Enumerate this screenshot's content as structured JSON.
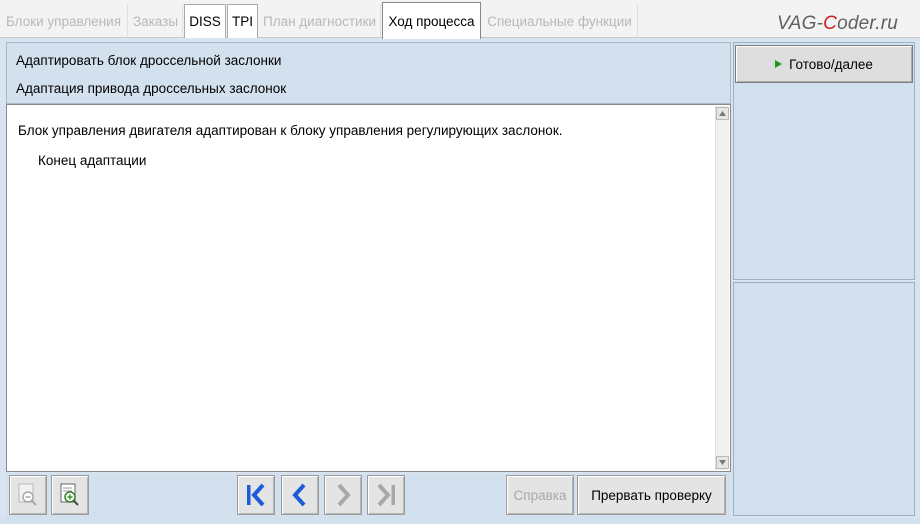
{
  "tabs": [
    {
      "label": "Блоки управления",
      "state": "disabled"
    },
    {
      "label": "Заказы",
      "state": "disabled"
    },
    {
      "label": "DISS",
      "state": "enabled"
    },
    {
      "label": "TPI",
      "state": "enabled"
    },
    {
      "label": "План диагностики",
      "state": "disabled"
    },
    {
      "label": "Ход процесса",
      "state": "active"
    },
    {
      "label": "Специальные функции",
      "state": "disabled"
    }
  ],
  "watermark": {
    "part1": "VAG-",
    "part2": "C",
    "part3": "oder.ru"
  },
  "header": {
    "line1": "Адаптировать блок дроссельной заслонки",
    "line2": "Адаптация привода дроссельных заслонок"
  },
  "content": {
    "main_text": "Блок управления двигателя адаптирован к блоку управления регулирующих заслонок.",
    "sub_text": "Конец адаптации"
  },
  "right_panel": {
    "done_label": "Готово/далее"
  },
  "toolbar": {
    "help_label": "Справка",
    "abort_label": "Прервать проверку"
  },
  "icons": {
    "zoom_out": "zoom-out-icon",
    "zoom_in": "zoom-in-icon",
    "first": "first-page-icon",
    "prev": "previous-icon",
    "next": "next-icon",
    "last": "last-page-icon",
    "play": "play-icon"
  },
  "colors": {
    "panel": "#d3e1ef",
    "nav_blue": "#1e5bd6",
    "nav_disabled": "#a8a8a8",
    "play_green": "#1f9a1f",
    "watermark_red": "#d22020"
  }
}
